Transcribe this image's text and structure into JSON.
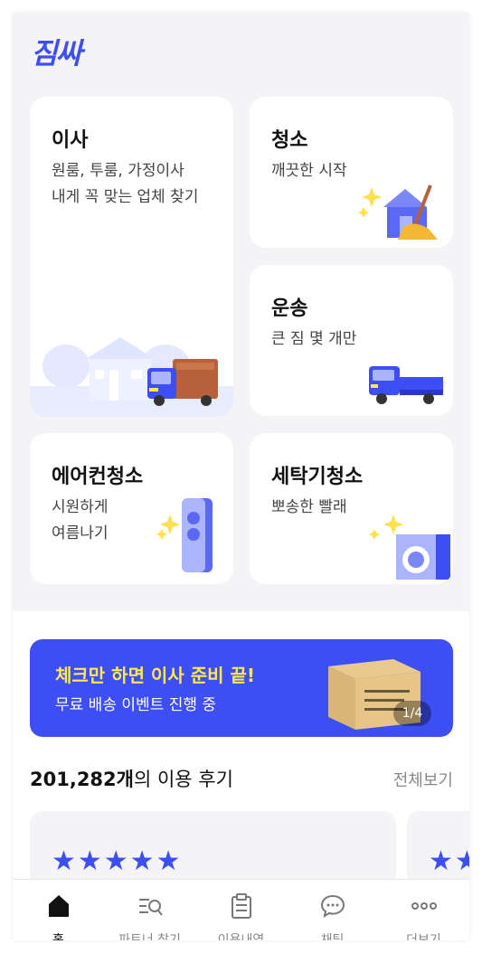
{
  "app": {
    "logo": "짐싸",
    "accent": "#3d4ef2",
    "banner_title_color": "#ffe94d"
  },
  "services": {
    "moving": {
      "title": "이사",
      "sub1": "원룸, 투룸, 가정이사",
      "sub2": "내게 꼭 맞는 업체 찾기"
    },
    "cleaning": {
      "title": "청소",
      "sub1": "깨끗한 시작"
    },
    "transport": {
      "title": "운송",
      "sub1": "큰 짐 몇 개만"
    },
    "aircon": {
      "title": "에어컨청소",
      "sub1": "시원하게",
      "sub2": "여름나기"
    },
    "washer": {
      "title": "세탁기청소",
      "sub1": "뽀송한 빨래"
    }
  },
  "banner": {
    "title": "체크만 하면 이사 준비 끝!",
    "subtitle": "무료 배송 이벤트 진행 중",
    "pager": "1/4"
  },
  "reviews": {
    "count": "201,282개",
    "suffix": "의 이용 후기",
    "see_all": "전체보기",
    "stars": "★★★★★"
  },
  "tabbar": [
    {
      "label": "홈",
      "icon": "home-icon",
      "active": true
    },
    {
      "label": "파트너 찾기",
      "icon": "search-list-icon",
      "active": false
    },
    {
      "label": "이용내역",
      "icon": "clipboard-icon",
      "active": false
    },
    {
      "label": "채팅",
      "icon": "chat-icon",
      "active": false
    },
    {
      "label": "더보기",
      "icon": "more-icon",
      "active": false
    }
  ]
}
